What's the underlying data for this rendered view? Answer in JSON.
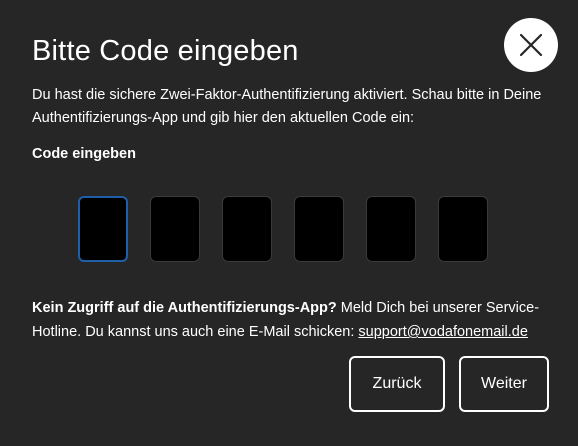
{
  "dialog": {
    "title": "Bitte Code eingeben",
    "description": "Du hast die sichere Zwei-Faktor-Authentifizierung aktiviert. Schau bitte in Deine Authentifizierungs-App und gib hier den aktuellen Code ein:",
    "code_label": "Code eingeben",
    "code_digits": [
      "",
      "",
      "",
      "",
      "",
      ""
    ],
    "help_bold": "Kein Zugriff auf die Authentifizierungs-App?",
    "help_text": " Meld Dich bei unserer Service-Hotline. Du kannst uns auch eine E-Mail schicken: ",
    "help_email": "support@vodafonemail.de",
    "back_label": "Zurück",
    "next_label": "Weiter",
    "close_icon": "close-icon"
  },
  "colors": {
    "background": "#262626",
    "input_background": "#000000",
    "focus_border": "#1f5fa8",
    "text": "#ffffff"
  }
}
